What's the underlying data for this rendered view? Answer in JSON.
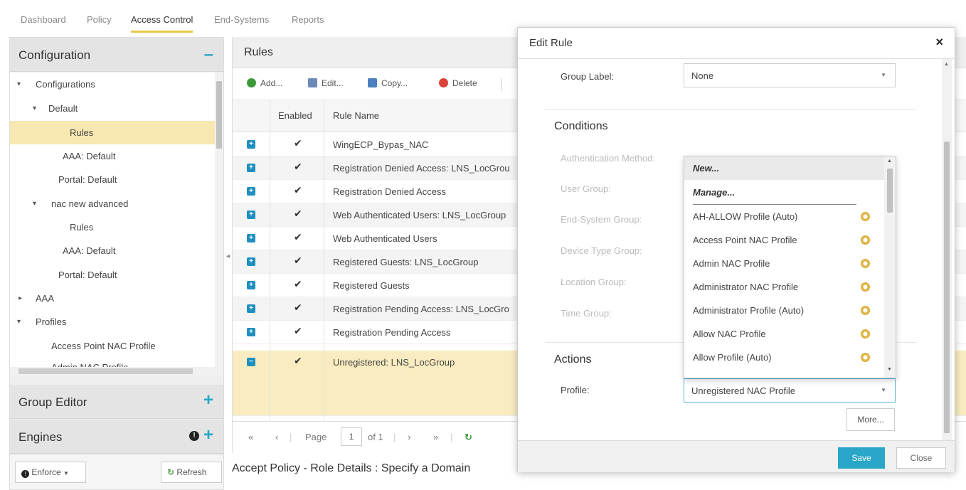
{
  "nav": {
    "tabs": [
      "Dashboard",
      "Policy",
      "Access Control",
      "End-Systems",
      "Reports"
    ],
    "active_tab": "Access Control"
  },
  "left": {
    "configuration": {
      "title": "Configuration",
      "collapse_icon": "minus-icon"
    },
    "tree": [
      {
        "label": "Configurations",
        "twisty": "▾"
      },
      {
        "label": "Default",
        "twisty": "▾"
      },
      {
        "label": "Rules",
        "twisty": ""
      },
      {
        "label": "AAA: Default",
        "twisty": ""
      },
      {
        "label": "Portal: Default",
        "twisty": ""
      },
      {
        "label": "nac new advanced",
        "twisty": "▾"
      },
      {
        "label": "Rules",
        "twisty": ""
      },
      {
        "label": "AAA: Default",
        "twisty": ""
      },
      {
        "label": "Portal: Default",
        "twisty": ""
      },
      {
        "label": "AAA",
        "twisty": "▸"
      },
      {
        "label": "Profiles",
        "twisty": "▾"
      },
      {
        "label": "Access Point NAC Profile",
        "twisty": ""
      },
      {
        "label": "Admin NAC Profile",
        "twisty": ""
      }
    ],
    "group_editor": {
      "title": "Group Editor",
      "add_icon": "plus-icon"
    },
    "engines": {
      "title": "Engines",
      "add_icon": "plus-icon",
      "alert_icon": "alert-icon"
    },
    "enforce_label": "Enforce",
    "refresh_label": "Refresh"
  },
  "rules": {
    "title": "Rules",
    "toolbar": {
      "add": "Add...",
      "edit": "Edit...",
      "copy": "Copy...",
      "delete": "Delete"
    },
    "columns": {
      "enabled": "Enabled",
      "name": "Rule Name"
    },
    "rows": [
      {
        "enabled": "✔",
        "name": "WingECP_Bypas_NAC"
      },
      {
        "enabled": "✔",
        "name": "Registration Denied Access: LNS_LocGrou"
      },
      {
        "enabled": "✔",
        "name": "Registration Denied Access"
      },
      {
        "enabled": "✔",
        "name": "Web Authenticated Users: LNS_LocGroup"
      },
      {
        "enabled": "✔",
        "name": "Web Authenticated Users"
      },
      {
        "enabled": "✔",
        "name": "Registered Guests: LNS_LocGroup"
      },
      {
        "enabled": "✔",
        "name": "Registered Guests"
      },
      {
        "enabled": "✔",
        "name": "Registration Pending Access: LNS_LocGro"
      },
      {
        "enabled": "✔",
        "name": "Registration Pending Access"
      },
      {
        "enabled": "✔",
        "name": "Unregistered: LNS_LocGroup"
      }
    ],
    "pager": {
      "first": "«",
      "prev": "‹",
      "page_label": "Page",
      "page": "1",
      "of": "of 1",
      "next": "›",
      "last": "»",
      "refresh_icon": "refresh-icon"
    }
  },
  "footer_title": "Accept Policy - Role Details : Specify a Domain",
  "dialog": {
    "title": "Edit Rule",
    "close": "×",
    "group_label": {
      "label": "Group Label:",
      "value": "None"
    },
    "conditions": {
      "title": "Conditions",
      "fields": [
        "Authentication Method:",
        "User Group:",
        "End-System Group:",
        "Device Type Group:",
        "Location Group:",
        "Time Group:"
      ]
    },
    "actions": {
      "title": "Actions",
      "profile": {
        "label": "Profile:",
        "value": "Unregistered NAC Profile"
      },
      "more": "More..."
    },
    "save": "Save",
    "close_btn": "Close"
  },
  "dropdown": {
    "items": [
      "New...",
      "Manage...",
      "AH-ALLOW Profile (Auto)",
      "Access Point NAC Profile",
      "Admin NAC Profile",
      "Administrator NAC Profile",
      "Administrator Profile (Auto)",
      "Allow NAC Profile",
      "Allow Profile (Auto)"
    ]
  },
  "colors": {
    "accent": "#2aa7c8",
    "selected_row": "#f8ecc0",
    "nav_underline": "#e8c84a"
  }
}
